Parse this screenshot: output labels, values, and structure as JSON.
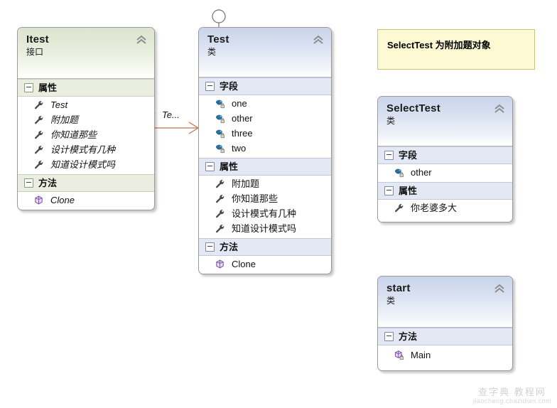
{
  "diagram": {
    "type": "uml-class-diagram",
    "background": "#ffffff"
  },
  "shapes": {
    "itest": {
      "name": "Itest",
      "stereotype": "接口",
      "kind": "interface",
      "compartments": [
        {
          "title": "属性",
          "members": [
            {
              "icon": "property-icon",
              "label": "Test"
            },
            {
              "icon": "property-icon",
              "label": "附加题"
            },
            {
              "icon": "property-icon",
              "label": "你知道那些"
            },
            {
              "icon": "property-icon",
              "label": "设计模式有几种"
            },
            {
              "icon": "property-icon",
              "label": "知道设计模式吗"
            }
          ]
        },
        {
          "title": "方法",
          "members": [
            {
              "icon": "method-icon",
              "label": "Clone"
            }
          ]
        }
      ]
    },
    "test": {
      "name": "Test",
      "stereotype": "类",
      "kind": "class",
      "compartments": [
        {
          "title": "字段",
          "members": [
            {
              "icon": "field-private-icon",
              "label": "one"
            },
            {
              "icon": "field-private-icon",
              "label": "other"
            },
            {
              "icon": "field-private-icon",
              "label": "three"
            },
            {
              "icon": "field-private-icon",
              "label": "two"
            }
          ]
        },
        {
          "title": "属性",
          "members": [
            {
              "icon": "property-icon",
              "label": "附加题"
            },
            {
              "icon": "property-icon",
              "label": "你知道那些"
            },
            {
              "icon": "property-icon",
              "label": "设计模式有几种"
            },
            {
              "icon": "property-icon",
              "label": "知道设计模式吗"
            }
          ]
        },
        {
          "title": "方法",
          "members": [
            {
              "icon": "method-icon",
              "label": "Clone"
            }
          ]
        }
      ]
    },
    "selecttest": {
      "name": "SelectTest",
      "stereotype": "类",
      "kind": "class",
      "compartments": [
        {
          "title": "字段",
          "members": [
            {
              "icon": "field-private-icon",
              "label": "other"
            }
          ]
        },
        {
          "title": "属性",
          "members": [
            {
              "icon": "property-icon",
              "label": "你老婆多大"
            }
          ]
        }
      ]
    },
    "start": {
      "name": "start",
      "stereotype": "类",
      "kind": "class",
      "compartments": [
        {
          "title": "方法",
          "members": [
            {
              "icon": "method-private-icon",
              "label": "Main"
            }
          ]
        }
      ]
    }
  },
  "note": {
    "text": "SelectTest 为附加题对象",
    "background": "#fdf9d2",
    "border": "#ccc27a"
  },
  "connector": {
    "kind": "association-arrow",
    "color": "#c0734a",
    "overflow_label": "Te..."
  },
  "lollipop": {
    "kind": "interface-implementation-lollipop",
    "color": "#6f6f6f"
  },
  "watermark": {
    "main": "查字典 教程网",
    "sub": "jiaocheng.chazidian.com"
  }
}
